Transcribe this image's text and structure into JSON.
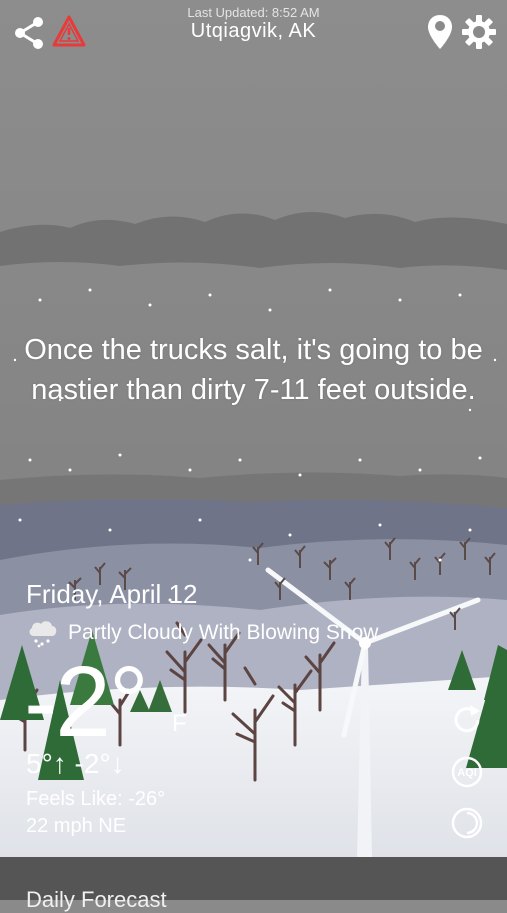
{
  "header": {
    "last_updated": "Last Updated: 8:52 AM",
    "location": "Utqiagvik, AK",
    "share_icon": "share-icon",
    "alert_icon": "warning-triangle-icon",
    "location_icon": "map-pin-icon",
    "settings_icon": "gear-icon"
  },
  "quote": "Once the trucks salt, it's going to be nastier than dirty 7-11 feet outside.",
  "weather": {
    "date": "Friday, April 12",
    "condition": "Partly Cloudy With Blowing Snow",
    "condition_icon": "cloud-snow-icon",
    "temperature": "-2°",
    "unit": "F",
    "hi_lo": "5°↑ -2°↓",
    "feels_like": "Feels Like: -26°",
    "wind": "22 mph NE"
  },
  "side_buttons": {
    "refresh_icon": "refresh-icon",
    "aqi_icon": "aqi-icon",
    "radar_icon": "radar-icon"
  },
  "footer": {
    "daily_forecast": "Daily Forecast"
  },
  "colors": {
    "sky": "#8a8a8a",
    "alert": "#e83a3a",
    "hills": "#7f8496",
    "snow": "#eef0f4"
  }
}
